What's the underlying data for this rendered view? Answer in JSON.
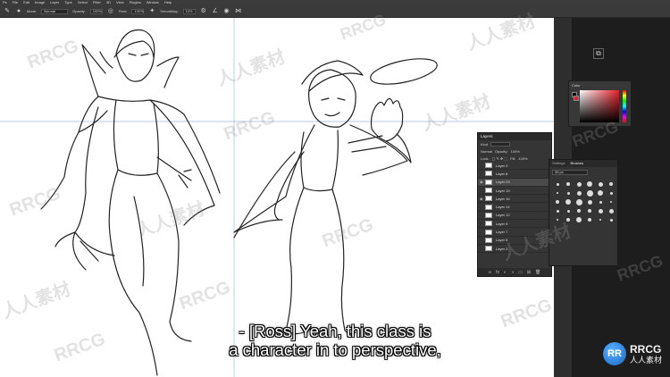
{
  "menu": [
    "Ps",
    "File",
    "Edit",
    "Image",
    "Layer",
    "Type",
    "Select",
    "Filter",
    "3D",
    "View",
    "Plugins",
    "Window",
    "Help"
  ],
  "options": {
    "mode_label": "Mode:",
    "mode_value": "Normal",
    "opacity_label": "Opacity:",
    "opacity_value": "100%",
    "flow_label": "Flow:",
    "flow_value": "100%",
    "smoothing_label": "Smoothing:",
    "smoothing_value": "10%"
  },
  "color_panel": {
    "tab": "Color",
    "foreground": "#000000",
    "background": "#e51f2b"
  },
  "layers_panel": {
    "title": "Layers",
    "kind_label": "Kind",
    "mode": "Normal",
    "opacity_label": "Opacity:",
    "opacity": "100%",
    "lock_label": "Lock:",
    "fill_label": "Fill:",
    "fill": "100%",
    "layers": [
      {
        "name": "Layer 0",
        "visible": false,
        "selected": false
      },
      {
        "name": "Layer 8",
        "visible": false,
        "selected": false
      },
      {
        "name": "Layer 23",
        "visible": true,
        "selected": true
      },
      {
        "name": "Layer 19",
        "visible": false,
        "selected": false
      },
      {
        "name": "Layer 16",
        "visible": true,
        "selected": false
      },
      {
        "name": "Layer 14",
        "visible": false,
        "selected": false
      },
      {
        "name": "Layer 12",
        "visible": false,
        "selected": false
      },
      {
        "name": "Layer 9",
        "visible": false,
        "selected": false
      },
      {
        "name": "Layer 7",
        "visible": false,
        "selected": false
      },
      {
        "name": "Layer 5",
        "visible": false,
        "selected": false
      },
      {
        "name": "Layer 3",
        "visible": false,
        "selected": false
      }
    ]
  },
  "brushes_panel": {
    "tabs": [
      "Settings",
      "Brushes"
    ],
    "active_tab": "Brushes",
    "size": "35 px"
  },
  "subtitle": {
    "line1": "- [Ross] Yeah, this class is",
    "line2": "a character in to perspective,"
  },
  "watermarks": [
    "RRCG",
    "人人素材"
  ],
  "logo": {
    "badge": "RR",
    "name": "RRCG",
    "tagline": "人人素材"
  }
}
